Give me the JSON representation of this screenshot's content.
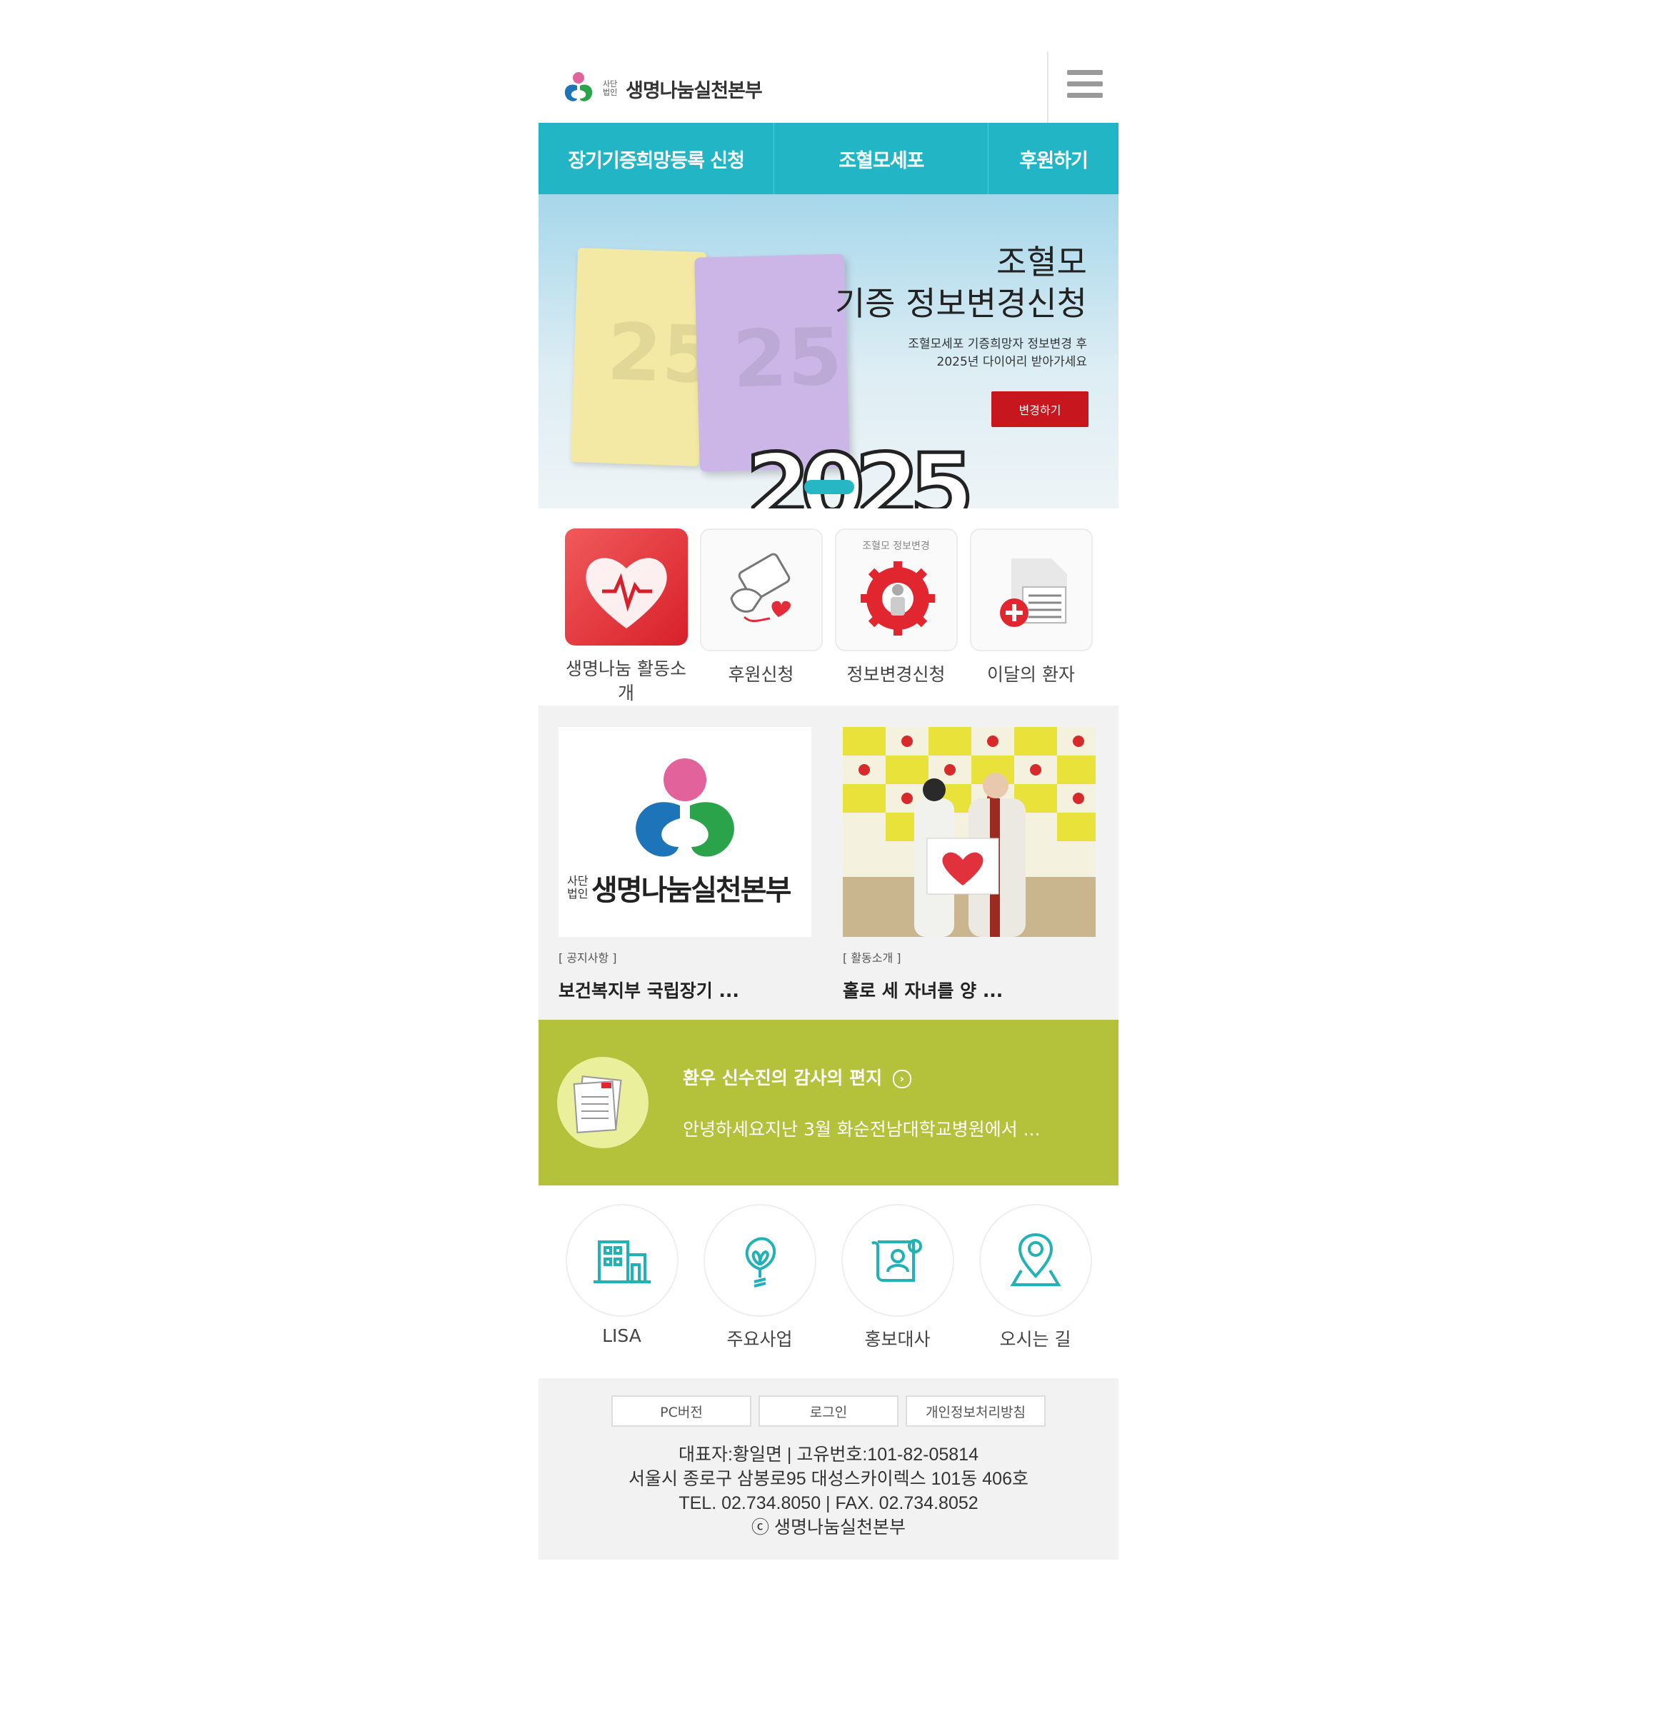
{
  "header": {
    "logo_sub": "사단 법인",
    "logo_text": "생명나눔실천본부"
  },
  "topnav": [
    {
      "label": "장기기증희망등록 신청"
    },
    {
      "label": "조혈모세포"
    },
    {
      "label": "후원하기"
    }
  ],
  "banner": {
    "title_line1": "조혈모",
    "title_line2": "기증 정보변경신청",
    "desc_line1": "조혈모세포 기증희망자 정보변경 후",
    "desc_line2": "2025년 다이어리 받아가세요",
    "button": "변경하기",
    "art_number": "2025"
  },
  "quick_icons": [
    {
      "label": "생명나눔 활동소개",
      "icon": "heart-pulse-icon"
    },
    {
      "label": "후원신청",
      "icon": "hand-heart-icon"
    },
    {
      "label": "정보변경신청",
      "icon": "gear-person-icon",
      "caption": "조혈모 정보변경"
    },
    {
      "label": "이달의 환자",
      "icon": "medical-document-icon"
    }
  ],
  "news": [
    {
      "category": "[ 공지사항 ]",
      "title": "보건복지부 국립장기 ...",
      "img_logo_sub": "사단 법인",
      "img_logo_text": "생명나눔실천본부"
    },
    {
      "category": "[ 활동소개 ]",
      "title": "홀로 세 자녀를 양 ..."
    }
  ],
  "letter": {
    "title": "환우 신수진의 감사의 편지",
    "text": "안녕하세요지난 3월 화순전남대학교병원에서 ..."
  },
  "round_icons": [
    {
      "label": "LISA",
      "icon": "building-icon"
    },
    {
      "label": "주요사업",
      "icon": "sprout-bulb-icon"
    },
    {
      "label": "홍보대사",
      "icon": "scroll-person-icon"
    },
    {
      "label": "오시는 길",
      "icon": "map-pin-icon"
    }
  ],
  "footer": {
    "links": [
      "PC버전",
      "로그인",
      "개인정보처리방침"
    ],
    "line1": "대표자:황일면 | 고유번호:101-82-05814",
    "line2": "서울시 종로구 삼봉로95 대성스카이렉스 101동 406호",
    "line3": "TEL. 02.734.8050 | FAX. 02.734.8052",
    "line4": "ⓒ 생명나눔실천본부"
  },
  "colors": {
    "teal": "#22b5c6",
    "green": "#b3c13b",
    "red": "#c8161e"
  }
}
